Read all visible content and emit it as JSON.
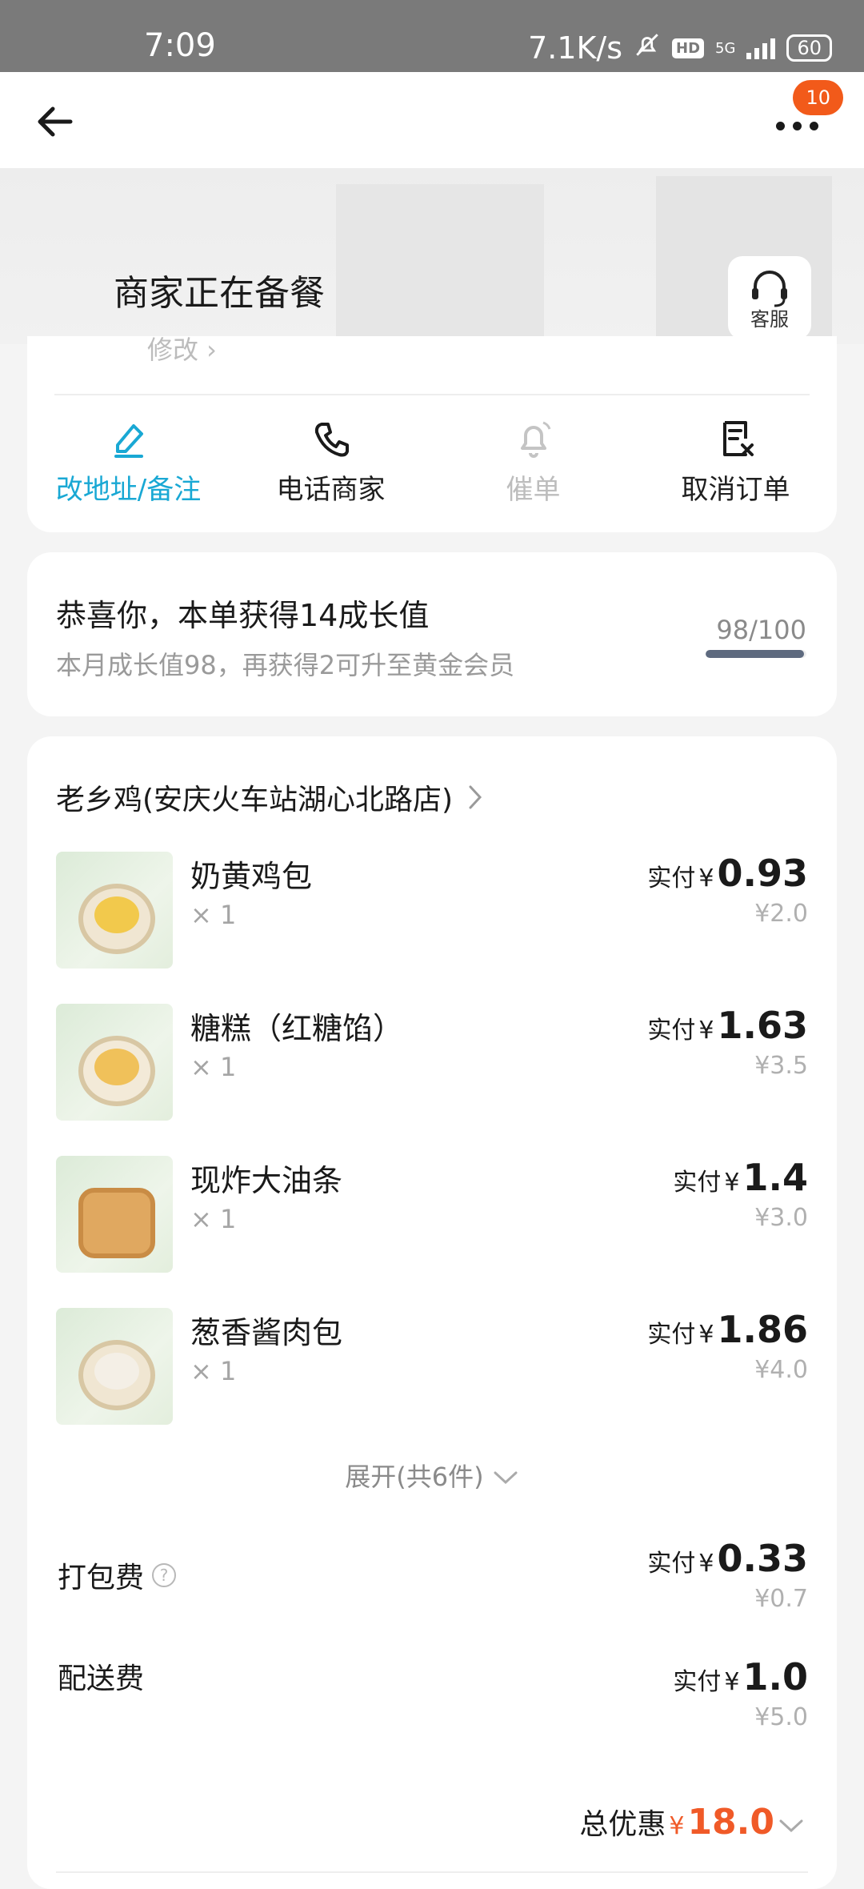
{
  "status_bar": {
    "time": "7:09",
    "speed": "7.1K/s",
    "hd": "HD",
    "network": "5G",
    "battery": "60"
  },
  "nav": {
    "badge_count": "10",
    "back_icon": "arrow-left-icon",
    "more_icon": "more-dots-icon"
  },
  "header": {
    "status_title": "商家正在备餐",
    "service_label": "客服",
    "partial_text": "修改 ›"
  },
  "actions": [
    {
      "label": "改地址/备注",
      "icon": "edit-icon",
      "state": "active"
    },
    {
      "label": "电话商家",
      "icon": "phone-icon",
      "state": "normal"
    },
    {
      "label": "催单",
      "icon": "bell-icon",
      "state": "disabled"
    },
    {
      "label": "取消订单",
      "icon": "cancel-order-icon",
      "state": "normal"
    }
  ],
  "growth": {
    "title": "恭喜你，本单获得14成长值",
    "subtitle": "本月成长值98，再获得2可升至黄金会员",
    "progress_text": "98/100",
    "progress_fraction": 0.98
  },
  "order": {
    "store_name": "老乡鸡(安庆火车站湖心北路店)",
    "pay_label": "实付",
    "yen": "¥",
    "items": [
      {
        "name": "奶黄鸡包",
        "qty": "× 1",
        "paid": "0.93",
        "original": "¥2.0"
      },
      {
        "name": "糖糕（红糖馅）",
        "qty": "× 1",
        "paid": "1.63",
        "original": "¥3.5"
      },
      {
        "name": "现炸大油条",
        "qty": "× 1",
        "paid": "1.4",
        "original": "¥3.0"
      },
      {
        "name": "葱香酱肉包",
        "qty": "× 1",
        "paid": "1.86",
        "original": "¥4.0"
      }
    ],
    "expand_label": "展开(共6件)",
    "packing_fee": {
      "label": "打包费",
      "paid": "0.33",
      "original": "¥0.7"
    },
    "delivery_fee": {
      "label": "配送费",
      "paid": "1.0",
      "original": "¥5.0"
    },
    "total_discount": {
      "label": "总优惠",
      "yen": "¥",
      "amount": "18.0"
    }
  },
  "colors": {
    "accent": "#19a8d4",
    "discount": "#f05a28",
    "badge": "#f25a1a"
  }
}
